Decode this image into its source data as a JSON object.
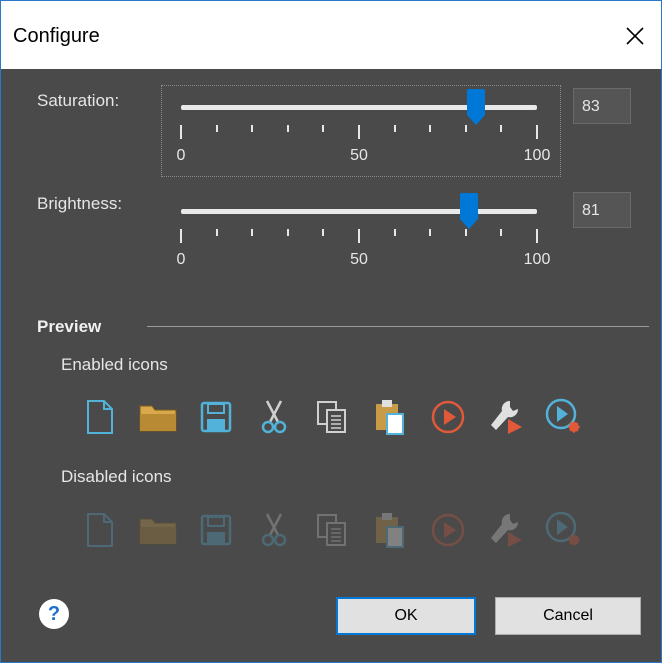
{
  "window": {
    "title": "Configure"
  },
  "saturation": {
    "label": "Saturation:",
    "value": "83",
    "fraction": 0.83,
    "ticks": [
      "0",
      "50",
      "100"
    ]
  },
  "brightness": {
    "label": "Brightness:",
    "value": "81",
    "fraction": 0.81,
    "ticks": [
      "0",
      "50",
      "100"
    ]
  },
  "preview": {
    "section_label": "Preview",
    "enabled_label": "Enabled icons",
    "disabled_label": "Disabled icons",
    "icons": [
      "new-file-icon",
      "open-folder-icon",
      "save-icon",
      "cut-icon",
      "copy-icon",
      "paste-icon",
      "run-icon",
      "build-icon",
      "debug-icon"
    ]
  },
  "buttons": {
    "ok": "OK",
    "cancel": "Cancel",
    "help": "?"
  },
  "colors": {
    "accent": "#0078d7",
    "icon_blue": "#52b2d9",
    "folder": "#d9a84a",
    "run": "#e05a3a"
  }
}
